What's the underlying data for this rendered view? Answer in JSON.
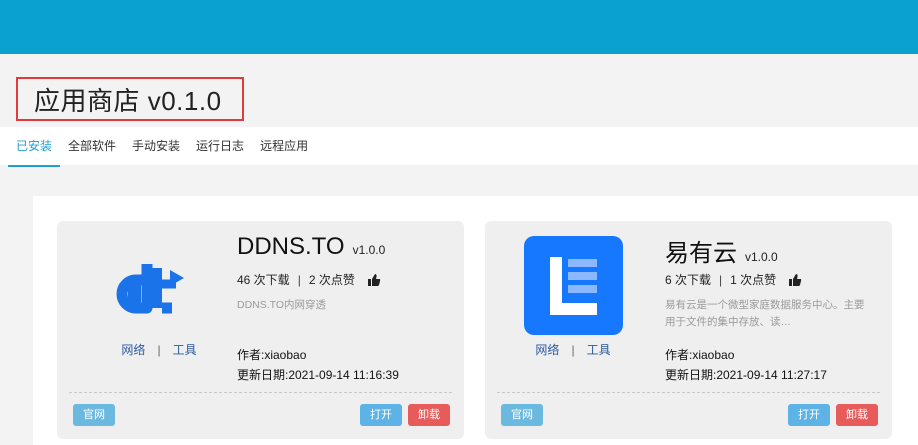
{
  "header": {
    "title": "应用商店 v0.1.0"
  },
  "tabs": [
    {
      "label": "已安装",
      "active": true
    },
    {
      "label": "全部软件"
    },
    {
      "label": "手动安装"
    },
    {
      "label": "运行日志"
    },
    {
      "label": "远程应用"
    }
  ],
  "apps": [
    {
      "name": "DDNS.TO",
      "version": "v1.0.0",
      "downloads": "46 次下载",
      "likes": "2 次点赞",
      "description": "DDNS.TO内网穿透",
      "tags": [
        "网络",
        "工具"
      ],
      "author": "作者:xiaobao",
      "updated": "更新日期:2021-09-14 11:16:39",
      "buttons": {
        "site": "官网",
        "open": "打开",
        "uninstall": "卸载"
      },
      "icon": "ddnsto-logo-icon",
      "brand_color": "#1a73e8"
    },
    {
      "name": "易有云",
      "version": "v1.0.0",
      "downloads": "6 次下载",
      "likes": "1 次点赞",
      "description": "易有云是一个微型家庭数据服务中心。主要用于文件的集中存放、读…",
      "tags": [
        "网络",
        "工具"
      ],
      "author": "作者:xiaobao",
      "updated": "更新日期:2021-09-14 11:27:17",
      "buttons": {
        "site": "官网",
        "open": "打开",
        "uninstall": "卸载"
      },
      "icon": "linkease-logo-icon",
      "brand_color": "#1677ff"
    }
  ],
  "colors": {
    "topbar": "#0aa0cf",
    "active_tab": "#20a0d0",
    "open_button": "#5db3e6",
    "uninstall_button": "#e85b5b",
    "title_highlight": "#e23b3b"
  }
}
